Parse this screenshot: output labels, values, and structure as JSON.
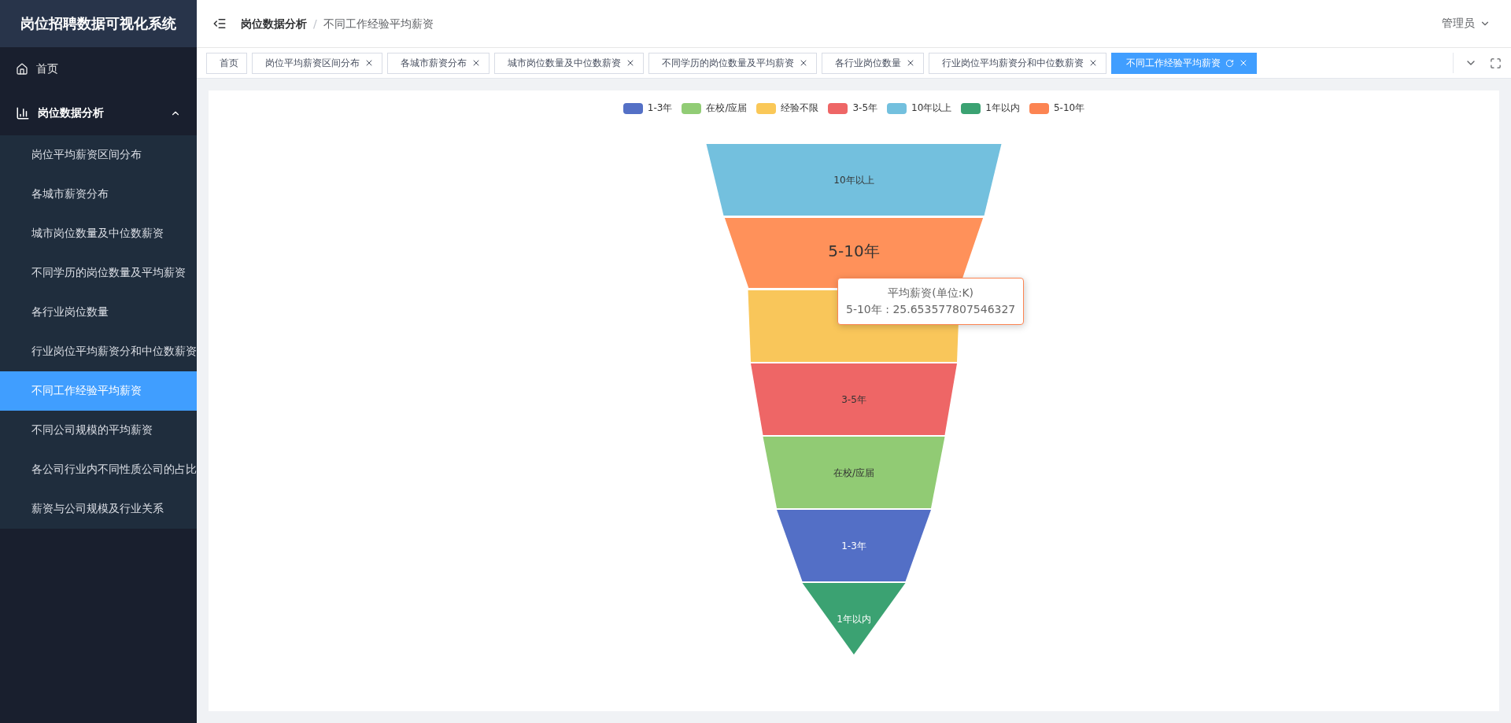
{
  "sidebar": {
    "title": "岗位招聘数据可视化系统",
    "items": [
      {
        "label": "首页",
        "kind": "link",
        "selected": false
      },
      {
        "label": "岗位数据分析",
        "kind": "group",
        "expanded": true,
        "children": [
          {
            "label": "岗位平均薪资区间分布",
            "selected": false
          },
          {
            "label": "各城市薪资分布",
            "selected": false
          },
          {
            "label": "城市岗位数量及中位数薪资",
            "selected": false
          },
          {
            "label": "不同学历的岗位数量及平均薪资",
            "selected": false
          },
          {
            "label": "各行业岗位数量",
            "selected": false
          },
          {
            "label": "行业岗位平均薪资分和中位数薪资",
            "selected": false
          },
          {
            "label": "不同工作经验平均薪资",
            "selected": true
          },
          {
            "label": "不同公司规模的平均薪资",
            "selected": false
          },
          {
            "label": "各公司行业内不同性质公司的占比",
            "selected": false
          },
          {
            "label": "薪资与公司规模及行业关系",
            "selected": false
          }
        ]
      }
    ]
  },
  "header": {
    "breadcrumb": [
      "岗位数据分析",
      "不同工作经验平均薪资"
    ],
    "separator": "/",
    "user": "管理员"
  },
  "tabs": [
    {
      "label": "首页",
      "selected": false,
      "closable": false
    },
    {
      "label": "岗位平均薪资区间分布",
      "selected": false,
      "closable": true
    },
    {
      "label": "各城市薪资分布",
      "selected": false,
      "closable": true
    },
    {
      "label": "城市岗位数量及中位数薪资",
      "selected": false,
      "closable": true
    },
    {
      "label": "不同学历的岗位数量及平均薪资",
      "selected": false,
      "closable": true
    },
    {
      "label": "各行业岗位数量",
      "selected": false,
      "closable": true
    },
    {
      "label": "行业岗位平均薪资分和中位数薪资",
      "selected": false,
      "closable": true
    },
    {
      "label": "不同工作经验平均薪资",
      "selected": true,
      "closable": true
    }
  ],
  "funnel": {
    "legend": [
      {
        "label": "1-3年",
        "color": "#5470c6"
      },
      {
        "label": "在校/应届",
        "color": "#91cc75"
      },
      {
        "label": "经验不限",
        "color": "#fac858"
      },
      {
        "label": "3-5年",
        "color": "#ee6666"
      },
      {
        "label": "10年以上",
        "color": "#73c0de"
      },
      {
        "label": "1年以内",
        "color": "#3ba272"
      },
      {
        "label": "5-10年",
        "color": "#fc8452"
      }
    ],
    "segments": [
      {
        "label": "10年以上",
        "color": "#73c0de",
        "hovered": false
      },
      {
        "label": "5-10年",
        "color": "#ff915a",
        "hovered": true
      },
      {
        "color": "#f9c65a",
        "hovered": false
      },
      {
        "label": "3-5年",
        "color": "#ee6666",
        "hovered": false
      },
      {
        "label": "在校/应届",
        "color": "#91cb74",
        "hovered": false
      },
      {
        "label": "1-3年",
        "color": "#536fc6",
        "hovered": false
      },
      {
        "label": "1年以内",
        "color": "#3ba272",
        "hovered": false
      }
    ],
    "tooltip": {
      "title": "平均薪资(单位:K)",
      "line": "5-10年 : 25.653577807546327",
      "color": "#fc8452"
    }
  }
}
